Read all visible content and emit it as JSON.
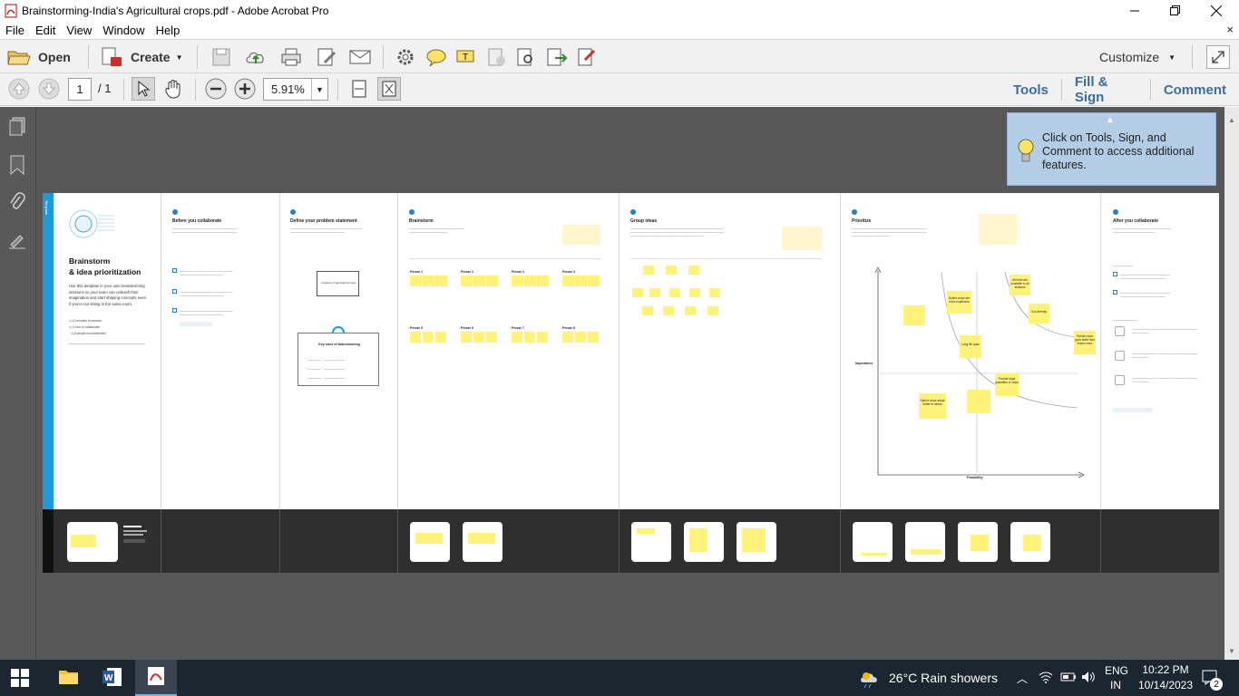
{
  "window": {
    "title": "Brainstorming-India's Agricultural crops.pdf - Adobe Acrobat Pro"
  },
  "menu": {
    "items": [
      "File",
      "Edit",
      "View",
      "Window",
      "Help"
    ],
    "close_glyph": "×"
  },
  "toolbar": {
    "open_label": "Open",
    "create_label": "Create",
    "customize_label": "Customize",
    "icons": [
      "save-icon",
      "upload-cloud-icon",
      "print-icon",
      "edit-document-icon",
      "email-icon",
      "settings-gear-icon",
      "comment-bubble-icon",
      "highlight-icon",
      "delete-page-icon",
      "search-document-icon",
      "export-icon",
      "redact-icon"
    ]
  },
  "nav": {
    "page_current": "1",
    "page_total": "/ 1",
    "zoom": "5.91%"
  },
  "panels": {
    "tools": "Tools",
    "fill_sign": "Fill & Sign",
    "comment": "Comment"
  },
  "tooltip": {
    "text": "Click on Tools, Sign, and Comment to access additional features."
  },
  "document": {
    "tab_label": "Template",
    "intro_title_1": "Brainstorm",
    "intro_title_2": "& idea prioritization",
    "intro_body": "Use this template in your own brainstorming sessions so your team can unleash their imagination and start shaping concepts even if you're not sitting in the same room.",
    "intro_meta": [
      "10 minutes to prepare",
      "1 hour to collaborate",
      "2-8 people recommended"
    ],
    "col_titles": [
      "Before you collaborate",
      "Define your problem statement",
      "Brainstorm",
      "Group ideas",
      "Prioritize",
      "After you collaborate"
    ],
    "col2_box": "Analysis of agricultural crops",
    "col2_rules_title": "Key rules of brainstorming",
    "person_labels": [
      "Person 1",
      "Person 2",
      "Person 3",
      "Person 4",
      "Person 5",
      "Person 6",
      "Person 7",
      "Person 8"
    ],
    "prioritize_axis_y": "Importance",
    "prioritize_axis_x": "Feasibility",
    "prioritize_notes": [
      "Hybrid crops are more expensive",
      "Long life span",
      "Hybrid crops adapt better to stress",
      "Provide large quantities of crops",
      "All fruits are available in all seasons",
      "Eco-friendly",
      "Hybrid crops grow faster and flower more"
    ]
  },
  "taskbar": {
    "weather": "26°C  Rain showers",
    "lang_1": "ENG",
    "lang_2": "IN",
    "time": "10:22 PM",
    "date": "10/14/2023",
    "notif_count": "2"
  },
  "colors": {
    "accent_blue": "#3d6d9c",
    "doc_side_band": "#1e9ad6",
    "sticky_yellow": "#fff27a",
    "taskbar": "#1c2631",
    "tooltip_bg": "#b3cde6"
  }
}
